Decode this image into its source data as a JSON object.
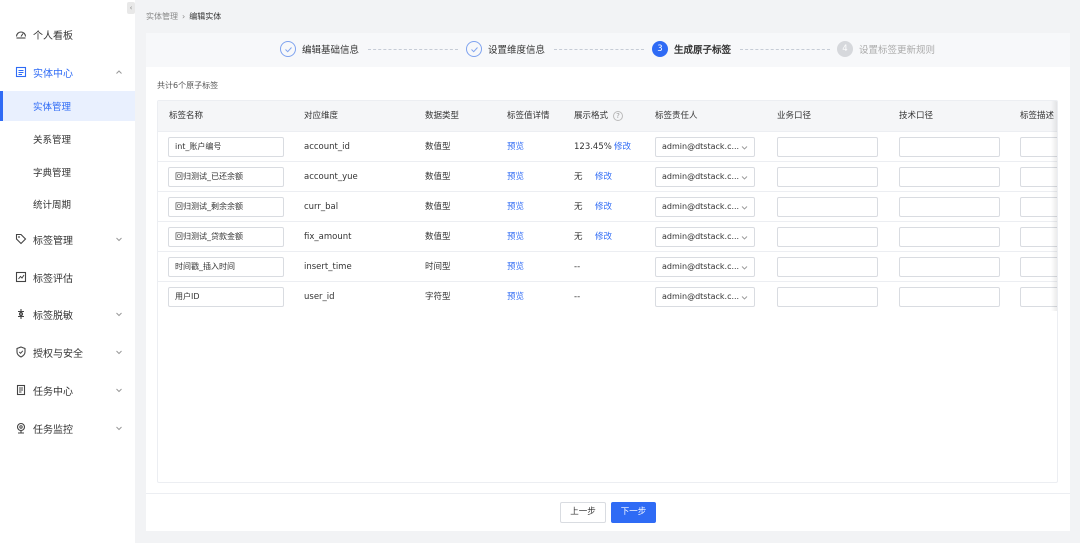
{
  "sidebar": {
    "items": [
      {
        "label": "个人看板",
        "icon": "dashboard-icon"
      },
      {
        "label": "实体中心",
        "icon": "entity-icon",
        "expanded": true
      },
      {
        "label": "标签管理",
        "icon": "tag-icon"
      },
      {
        "label": "标签评估",
        "icon": "evaluate-icon"
      },
      {
        "label": "标签脱敏",
        "icon": "desensitize-icon"
      },
      {
        "label": "授权与安全",
        "icon": "shield-icon"
      },
      {
        "label": "任务中心",
        "icon": "task-icon"
      },
      {
        "label": "任务监控",
        "icon": "monitor-icon"
      }
    ],
    "subitems": [
      {
        "label": "实体管理",
        "active": true
      },
      {
        "label": "关系管理"
      },
      {
        "label": "字典管理"
      },
      {
        "label": "统计周期"
      }
    ],
    "collapse_glyph": "‹"
  },
  "breadcrumb": {
    "parent": "实体管理",
    "separator": "›",
    "current": "编辑实体"
  },
  "steps": [
    {
      "label": "编辑基础信息",
      "state": "done"
    },
    {
      "label": "设置维度信息",
      "state": "done"
    },
    {
      "label": "生成原子标签",
      "state": "current",
      "num": "3"
    },
    {
      "label": "设置标签更新规则",
      "state": "todo",
      "num": "4"
    }
  ],
  "count_text": "共计6个原子标签",
  "table": {
    "headers": [
      "标签名称",
      "对应维度",
      "数据类型",
      "标签值详情",
      "展示格式",
      "标签责任人",
      "业务口径",
      "技术口径",
      "标签描述"
    ],
    "help_glyph": "?",
    "rows": [
      {
        "name": "int_账户编号",
        "dim": "account_id",
        "type": "数值型",
        "detail": "预览",
        "format": "123.45%",
        "edit": "修改",
        "owner": "admin@dtstack.c...",
        "biz": "",
        "tech": "",
        "desc": ""
      },
      {
        "name": "回归测试_已还余额",
        "dim": "account_yue",
        "type": "数值型",
        "detail": "预览",
        "format": "无",
        "edit": "修改",
        "owner": "admin@dtstack.c...",
        "biz": "",
        "tech": "",
        "desc": ""
      },
      {
        "name": "回归测试_剩余余额",
        "dim": "curr_bal",
        "type": "数值型",
        "detail": "预览",
        "format": "无",
        "edit": "修改",
        "owner": "admin@dtstack.c...",
        "biz": "",
        "tech": "",
        "desc": ""
      },
      {
        "name": "回归测试_贷款金额",
        "dim": "fix_amount",
        "type": "数值型",
        "detail": "预览",
        "format": "无",
        "edit": "修改",
        "owner": "admin@dtstack.c...",
        "biz": "",
        "tech": "",
        "desc": ""
      },
      {
        "name": "时间戳_插入时间",
        "dim": "insert_time",
        "type": "时间型",
        "detail": "预览",
        "format": "--",
        "edit": "",
        "owner": "admin@dtstack.c...",
        "biz": "",
        "tech": "",
        "desc": ""
      },
      {
        "name": "用户ID",
        "dim": "user_id",
        "type": "字符型",
        "detail": "预览",
        "format": "--",
        "edit": "",
        "owner": "admin@dtstack.c...",
        "biz": "",
        "tech": "",
        "desc": ""
      }
    ]
  },
  "buttons": {
    "prev": "上一步",
    "next": "下一步"
  },
  "colors": {
    "primary": "#2f6bf5",
    "active_bg": "#e9f0fe"
  }
}
